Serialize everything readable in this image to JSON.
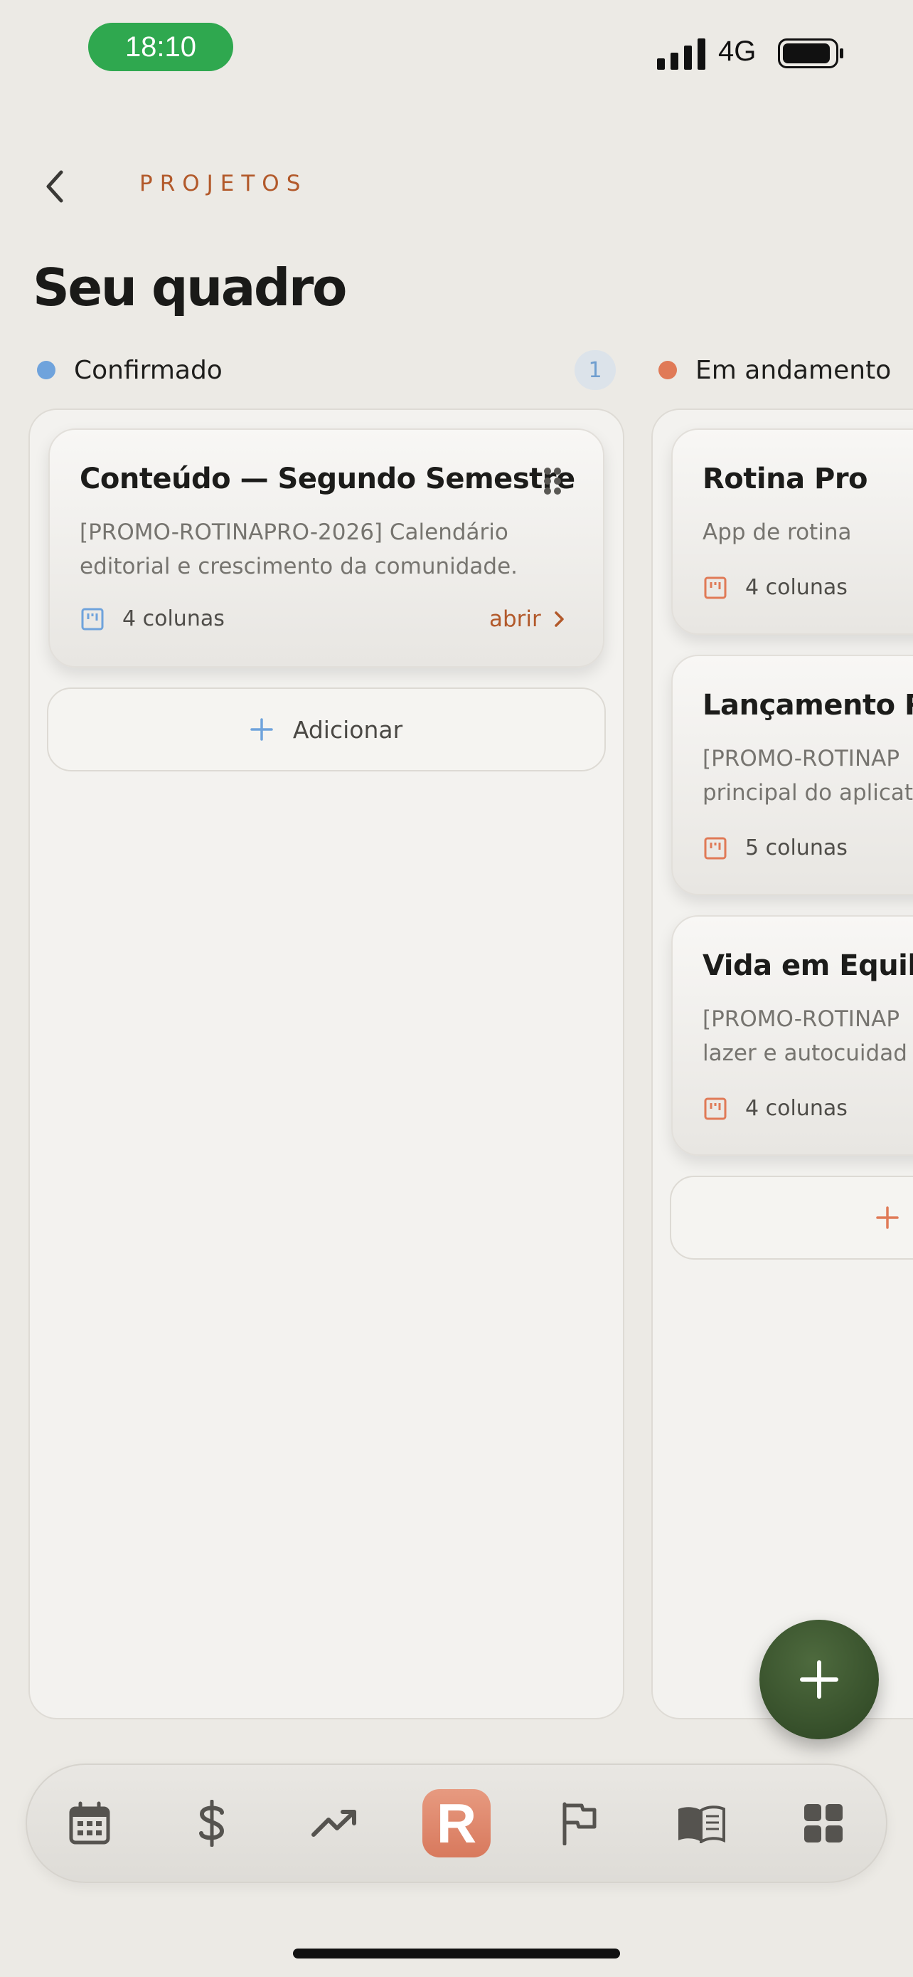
{
  "status_bar": {
    "time": "18:10",
    "network": "4G"
  },
  "header": {
    "section_label": "PROJETOS",
    "title": "Seu quadro"
  },
  "columns": [
    {
      "name": "Confirmado",
      "dot_color": "#6FA3DC",
      "count": "1",
      "cards": [
        {
          "title": "Conteúdo — Segundo Semestre",
          "description_line1": "[PROMO-ROTINAPRO-2026] Calendário",
          "description_line2": "editorial e crescimento da comunidade.",
          "columns_label": "4 colunas",
          "open_label": "abrir"
        }
      ],
      "add_label": "Adicionar"
    },
    {
      "name": "Em andamento",
      "dot_color": "#E07A57",
      "cards": [
        {
          "title": "Rotina Pro",
          "description_line1": "App de rotina",
          "columns_label": "4 colunas"
        },
        {
          "title": "Lançamento Ro",
          "description_line1": "[PROMO-ROTINAP",
          "description_line2": "principal do aplicat",
          "columns_label": "5 colunas"
        },
        {
          "title": "Vida em Equilíb",
          "description_line1": "[PROMO-ROTINAP",
          "description_line2": "lazer e autocuidad",
          "columns_label": "4 colunas"
        }
      ]
    }
  ],
  "tab_bar": {
    "items": [
      "calendar-icon",
      "dollar-icon",
      "trending-up-icon",
      "app-logo-tab",
      "flag-icon",
      "book-icon",
      "grid-icon"
    ],
    "active_tab_letter": "R",
    "accent_color": "#DB7D62"
  },
  "fab": {
    "icon": "plus-icon",
    "color": "#3A5430"
  }
}
